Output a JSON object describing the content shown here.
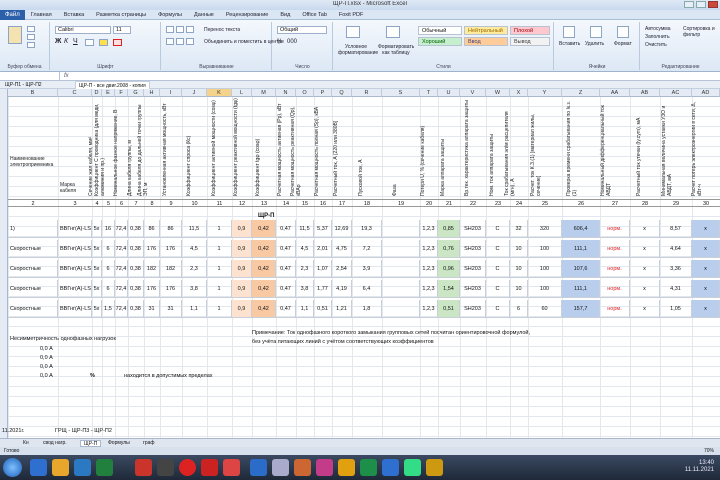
{
  "window": {
    "title": "ЩР-П.xlsx - Microsoft Excel"
  },
  "menu": {
    "file": "Файл",
    "tabs": [
      "Главная",
      "Вставка",
      "Разметка страницы",
      "Формулы",
      "Данные",
      "Рецензирование",
      "Вид",
      "Office Tab",
      "Foxit PDF"
    ]
  },
  "ribbon": {
    "font_name": "Calibri",
    "font_size": "11",
    "wrap_text": "Перенос текста",
    "merge_center": "Объединить и поместить в центре",
    "number_format": "Общий",
    "cond_format": "Условное форматирование",
    "format_as_table": "Форматировать как таблицу",
    "styles": {
      "normal": "Обычный",
      "neutral": "Нейтральный",
      "bad": "Плохой",
      "good": "Хороший",
      "input": "Ввод",
      "output": "Вывод"
    },
    "cells": {
      "insert": "Вставить",
      "delete": "Удалить",
      "format": "Формат"
    },
    "editing": {
      "autosum": "Автосумма",
      "fill": "Заполнить",
      "clear": "Очистить",
      "sort": "Сортировка и фильтр",
      "find": "Найти и выделить"
    },
    "groups": [
      "Буфер обмена",
      "Шрифт",
      "Выравнивание",
      "Число",
      "Стили",
      "Ячейки",
      "Редактирование"
    ]
  },
  "doc_tabs": [
    "ЩР-П1 - ЩР-П2",
    "ЩР-П - все двиг.2008 - копия"
  ],
  "columns": [
    "B",
    "C",
    "D",
    "E",
    "F",
    "G",
    "H",
    "I",
    "J",
    "K",
    "L",
    "M",
    "N",
    "O",
    "P",
    "Q",
    "R",
    "S",
    "T",
    "U",
    "V",
    "W",
    "X",
    "Y",
    "Z",
    "AA",
    "AB",
    "AC",
    "AD"
  ],
  "selected_column": "K",
  "headers": [
    "Наименование электроприемника",
    "Марка кабеля",
    "Сечение жил кабеля, мм²",
    "Коэффициент С проводника (для меди, алюминия и пр.)",
    "Номинальное фазное напряжение, В",
    "Длина кабеля группы, м",
    "Длина кабеля до дальней точки группы ЭП, м",
    "Установленная активная мощность, кВт",
    "Коэффициент спроса (Кс)",
    "Коэффициент активной мощности (cosφ)",
    "Коэффициент реактивной мощности (tgφ)",
    "Коэффициент tgφ (cosφ)",
    "Расчетная мощность активная (Рр), кВт",
    "Расчетная мощность реактивная (Qр), кВАр",
    "Расчетная мощность полная (Sр), кВА",
    "Расчетный ток, А [220 или 380В]",
    "Пусковой ток, А",
    "Фаза",
    "Потери U, % (сечение кабеля)",
    "Марка аппарата защиты",
    "Вр.тек. характеристика аппарата защиты",
    "Ном. ток аппарата защиты",
    "Ток срабатывания эл/м расцепителя (мгн), А",
    "Расчет. ток К.З.(1) [материал жилы, сечение]",
    "Проверка времени срабатывания по Ік.з.(1)",
    "Номинальный дифференциальный ток АВДТ",
    "Расчетный ток утечки (Iy.cym), мА",
    "Минимальная величина уставки УЗО и АВДТ, мА",
    "Расчет потерь электроэнергии в сети, Δ, кВт·ч"
  ],
  "col_numbers": [
    "2",
    "3",
    "4",
    "5",
    "6",
    "7",
    "8",
    "9",
    "10",
    "11",
    "12",
    "13",
    "14",
    "15",
    "16",
    "17",
    "18",
    "19",
    "20",
    "21",
    "22",
    "23",
    "24",
    "25",
    "26",
    "27",
    "28",
    "29",
    "30"
  ],
  "group_label": "ЩР-П",
  "rows": [
    {
      "name": "1)",
      "cable": "ВВГнг(A)-LS",
      "section": "5х",
      "c": "16",
      "u": "72,4",
      "len1": "0,38",
      "len2": "86",
      "p": "86",
      "kc": "11,5",
      "k1": "1",
      "cos": "0,9",
      "tg": "0,42",
      "tg2": "0,47",
      "pp": "11,5",
      "qp": "5,37",
      "sp": "12,69",
      "ip": "19,3",
      "istart": "",
      "phase": "1,2,3",
      "du": "0,85",
      "brand": "SH203",
      "char": "С",
      "inom": "32",
      "imag": "320",
      "ikz": "606,4",
      "check": "норм.",
      "idiff": "х",
      "ileak": "8,57",
      "ustav": "х"
    },
    {
      "name": "Скоростные",
      "cable": "ВВГнг(A)-LS",
      "section": "5х",
      "c": "6",
      "u": "72,4",
      "len1": "0,38",
      "len2": "176",
      "p": "176",
      "kc": "4,5",
      "k1": "1",
      "cos": "0,9",
      "tg": "0,42",
      "tg2": "0,47",
      "pp": "4,5",
      "qp": "2,01",
      "sp": "4,75",
      "ip": "7,2",
      "istart": "",
      "phase": "1,2,3",
      "du": "0,76",
      "brand": "SH203",
      "char": "С",
      "inom": "10",
      "imag": "100",
      "ikz": "111,1",
      "check": "норм.",
      "idiff": "х",
      "ileak": "4,64",
      "ustav": "х"
    },
    {
      "name": "Скоростные",
      "cable": "ВВГнг(A)-LS",
      "section": "5х",
      "c": "6",
      "u": "72,4",
      "len1": "0,38",
      "len2": "182",
      "p": "182",
      "kc": "2,3",
      "k1": "1",
      "cos": "0,9",
      "tg": "0,42",
      "tg2": "0,47",
      "pp": "2,3",
      "qp": "1,07",
      "sp": "2,54",
      "ip": "3,9",
      "istart": "",
      "phase": "1,2,3",
      "du": "0,96",
      "brand": "SH203",
      "char": "С",
      "inom": "10",
      "imag": "100",
      "ikz": "107,6",
      "check": "норм.",
      "idiff": "х",
      "ileak": "3,36",
      "ustav": "х"
    },
    {
      "name": "Скоростные",
      "cable": "ВВГнг(A)-LS",
      "section": "5х",
      "c": "6",
      "u": "72,4",
      "len1": "0,38",
      "len2": "176",
      "p": "176",
      "kc": "3,8",
      "k1": "1",
      "cos": "0,9",
      "tg": "0,42",
      "tg2": "0,47",
      "pp": "3,8",
      "qp": "1,77",
      "sp": "4,19",
      "ip": "6,4",
      "istart": "",
      "phase": "1,2,3",
      "du": "1,54",
      "brand": "SH203",
      "char": "С",
      "inom": "10",
      "imag": "100",
      "ikz": "111,1",
      "check": "норм.",
      "idiff": "х",
      "ileak": "4,31",
      "ustav": "х"
    },
    {
      "name": "Скоростные",
      "cable": "ВВГнг(A)-LS",
      "section": "5х",
      "c": "1,5",
      "u": "72,4",
      "len1": "0,38",
      "len2": "31",
      "p": "31",
      "kc": "1,1",
      "k1": "1",
      "cos": "0,9",
      "tg": "0,42",
      "tg2": "0,47",
      "pp": "1,1",
      "qp": "0,51",
      "sp": "1,21",
      "ip": "1,8",
      "istart": "",
      "phase": "1,2,3",
      "du": "0,51",
      "brand": "SH203",
      "char": "С",
      "inom": "6",
      "imag": "60",
      "ikz": "157,7",
      "check": "норм.",
      "idiff": "х",
      "ileak": "1,05",
      "ustav": "х"
    }
  ],
  "footer": {
    "asym_title": "Несимметричность однофазных нагрузок",
    "asym_vals": [
      "0,0 А",
      "0,0 А",
      "0,0 А",
      "0,0 А"
    ],
    "pct_label": "%",
    "asym_text": "находится в допустимых пределах",
    "note1": "Примечание: Ток однофазного короткого замыкания групповых сетей посчитан ориентировочной формулой,",
    "note2": "без учёта питающих линий с учётом соответствующих коэффициентов",
    "date": "11.2021г.",
    "doc_code": "ГРЩ - ЩР-П3 - ЩР-П2"
  },
  "sheet_tabs": [
    "Кн",
    "свод нагр.",
    "ЩР-П",
    "Формулы",
    "граф"
  ],
  "status": {
    "ready": "Готово",
    "zoom": "70%"
  },
  "clock": {
    "time": "13:40",
    "date": "11.11.2021"
  }
}
